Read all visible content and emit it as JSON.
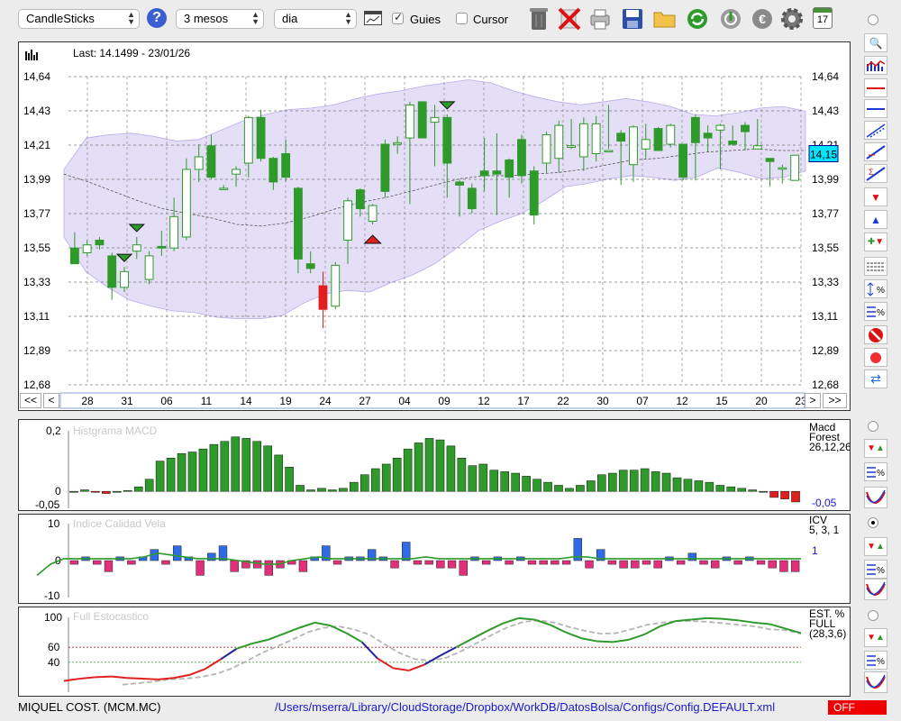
{
  "toolbar": {
    "chart_type": "CandleSticks",
    "period": "3 mesos",
    "interval": "dia",
    "guides_label": "Guies",
    "guides_checked": true,
    "cursor_label": "Cursor",
    "cursor_checked": false,
    "calendar_day": "17"
  },
  "price_chart": {
    "last_label": "Last: 14.1499 - 23/01/26",
    "current_price": "14,15",
    "y_ticks": [
      "14,64",
      "14,43",
      "14,21",
      "13,99",
      "13,77",
      "13,55",
      "13,33",
      "13,11",
      "12,89",
      "12,68"
    ],
    "x_ticks": [
      "28",
      "31",
      "06",
      "11",
      "14",
      "19",
      "24",
      "27",
      "04",
      "09",
      "12",
      "17",
      "22",
      "30",
      "07",
      "12",
      "15",
      "20",
      "23"
    ]
  },
  "nav": {
    "first": "<<",
    "prev": "<",
    "next": ">",
    "last": ">>"
  },
  "macd": {
    "title": "Histgrama MACD",
    "y_ticks": [
      "0,2",
      "0",
      "-0,05"
    ],
    "legend": [
      "Macd",
      "Forest",
      "26,12,26"
    ],
    "value": "-0,05"
  },
  "icv": {
    "title": "Indice Calidad Vela",
    "y_ticks": [
      "10",
      "0",
      "-10"
    ],
    "legend": [
      "ICV",
      "5, 3, 1"
    ],
    "value": "1"
  },
  "stoch": {
    "title": "Full Estocastico",
    "y_ticks": [
      "100",
      "60",
      "40"
    ],
    "legend": [
      "EST. %",
      "FULL",
      "(28,3,6)"
    ]
  },
  "status": {
    "instrument": "MIQUEL COST. (MCM.MC)",
    "path": "/Users/mserra/Library/CloudStorage/Dropbox/WorkDB/DatosBolsa/Configs/Config.DEFAULT.xml",
    "state": "OFF"
  },
  "colors": {
    "up": "#2e9a2a",
    "down": "#e21f1f",
    "band": "#ddd6f4",
    "accent": "#00e5ff",
    "hist_pos": "#2e9a2a",
    "hist_neg": "#e21f1f",
    "icv_pos": "#2f6be6",
    "icv_neg": "#e0307a"
  },
  "chart_data": [
    {
      "type": "candlestick",
      "ylim": [
        12.68,
        14.64
      ],
      "values_ohlc": [
        [
          13.55,
          13.45,
          13.65,
          13.45
        ],
        [
          13.52,
          13.57,
          13.6,
          13.5
        ],
        [
          13.6,
          13.57,
          13.62,
          13.54
        ],
        [
          13.5,
          13.3,
          13.52,
          13.22
        ],
        [
          13.3,
          13.4,
          13.43,
          13.27
        ],
        [
          13.53,
          13.57,
          13.62,
          13.48
        ],
        [
          13.35,
          13.5,
          13.53,
          13.32
        ],
        [
          13.56,
          13.55,
          13.66,
          13.5
        ],
        [
          13.55,
          13.75,
          13.87,
          13.53
        ],
        [
          13.62,
          14.05,
          14.12,
          13.6
        ],
        [
          14.05,
          14.13,
          14.21,
          13.97
        ],
        [
          14.2,
          14.0,
          14.27,
          13.99
        ],
        [
          13.93,
          13.93,
          13.95,
          13.92
        ],
        [
          14.02,
          14.05,
          14.07,
          13.94
        ],
        [
          14.09,
          14.38,
          14.39,
          14.0
        ],
        [
          14.38,
          14.12,
          14.43,
          14.1
        ],
        [
          14.12,
          13.97,
          14.13,
          13.92
        ],
        [
          14.15,
          14.0,
          14.24,
          13.97
        ],
        [
          13.93,
          13.48,
          13.94,
          13.39
        ],
        [
          13.45,
          13.42,
          13.53,
          13.39
        ],
        [
          13.31,
          13.16,
          13.4,
          13.04
        ],
        [
          13.18,
          13.44,
          13.46,
          13.16
        ],
        [
          13.6,
          13.85,
          13.87,
          13.45
        ],
        [
          13.92,
          13.8,
          13.93,
          13.75
        ],
        [
          13.72,
          13.82,
          13.83,
          13.7
        ],
        [
          14.21,
          13.91,
          14.24,
          13.87
        ],
        [
          14.21,
          14.22,
          14.26,
          14.15
        ],
        [
          14.25,
          14.46,
          14.48,
          13.83
        ],
        [
          14.48,
          14.25,
          14.48,
          14.25
        ],
        [
          14.35,
          14.38,
          14.46,
          14.07
        ],
        [
          14.38,
          14.09,
          14.4,
          13.87
        ],
        [
          13.97,
          13.95,
          13.98,
          13.75
        ],
        [
          13.93,
          13.8,
          13.96,
          13.77
        ],
        [
          14.04,
          14.01,
          14.25,
          13.91
        ],
        [
          14.04,
          14.02,
          14.28,
          13.76
        ],
        [
          14.11,
          14.0,
          14.12,
          13.87
        ],
        [
          14.24,
          14.01,
          14.27,
          13.96
        ],
        [
          14.04,
          13.76,
          14.07,
          13.7
        ],
        [
          14.09,
          14.27,
          14.29,
          14.03
        ],
        [
          14.12,
          14.33,
          14.36,
          14.03
        ],
        [
          14.19,
          14.2,
          14.37,
          14.18
        ],
        [
          14.13,
          14.34,
          14.38,
          14.04
        ],
        [
          14.15,
          14.34,
          14.39,
          14.1
        ],
        [
          14.17,
          14.17,
          14.46,
          14.18
        ],
        [
          14.28,
          14.23,
          14.3,
          13.95
        ],
        [
          14.08,
          14.32,
          14.33,
          13.97
        ],
        [
          14.18,
          14.24,
          14.34,
          14.12
        ],
        [
          14.31,
          14.17,
          14.32,
          14.18
        ],
        [
          14.21,
          14.33,
          14.34,
          14.19
        ],
        [
          14.21,
          14.0,
          14.21,
          13.98
        ],
        [
          14.38,
          14.22,
          14.4,
          13.98
        ],
        [
          14.28,
          14.25,
          14.33,
          14.16
        ],
        [
          14.3,
          14.33,
          14.34,
          14.05
        ],
        [
          14.23,
          14.21,
          14.33,
          14.2
        ],
        [
          14.33,
          14.29,
          14.35,
          14.17
        ],
        [
          14.18,
          14.2,
          14.37,
          14.2
        ],
        [
          14.12,
          14.1,
          14.11,
          13.94
        ],
        [
          14.06,
          14.06,
          14.08,
          13.96
        ],
        [
          13.98,
          14.14,
          14.14,
          13.98
        ]
      ],
      "bollinger_upper": [
        14.05,
        14.25,
        14.27,
        14.28,
        14.26,
        14.23,
        14.24,
        14.3,
        14.36,
        14.4,
        14.43,
        14.44,
        14.46,
        14.5,
        14.53,
        14.55,
        14.58,
        14.6,
        14.62,
        14.6,
        14.55,
        14.51,
        14.48,
        14.46,
        14.48,
        14.5,
        14.48,
        14.45,
        14.4,
        14.39,
        14.41,
        14.44,
        14.45,
        14.42
      ],
      "bollinger_lower": [
        13.62,
        13.4,
        13.3,
        13.22,
        13.18,
        13.15,
        13.14,
        13.11,
        13.1,
        13.1,
        13.12,
        13.2,
        13.26,
        13.28,
        13.27,
        13.33,
        13.38,
        13.45,
        13.55,
        13.66,
        13.72,
        13.77,
        13.85,
        13.94,
        13.96,
        13.99,
        14.01,
        14.0,
        13.98,
        14.0,
        14.06,
        14.03,
        13.99,
        14.0,
        14.04
      ],
      "sma": [
        14.02,
        13.97,
        13.91,
        13.85,
        13.8,
        13.77,
        13.74,
        13.7,
        13.69,
        13.71,
        13.75,
        13.8,
        13.84,
        13.87,
        13.91,
        13.95,
        13.99,
        14.01,
        14.01,
        14.02,
        14.03,
        14.05,
        14.08,
        14.11,
        14.12,
        14.14,
        14.16,
        14.17,
        14.18,
        14.17,
        14.17
      ],
      "signals": [
        "sell@4",
        "sell@5",
        "buy@24",
        "sell@30"
      ]
    },
    {
      "type": "bar",
      "name": "MACD",
      "ylim": [
        -0.05,
        0.2
      ],
      "values": [
        0,
        0.005,
        -0.003,
        -0.007,
        0,
        0.003,
        0.015,
        0.04,
        0.1,
        0.11,
        0.125,
        0.13,
        0.14,
        0.155,
        0.165,
        0.18,
        0.175,
        0.165,
        0.15,
        0.12,
        0.08,
        0.02,
        0.005,
        0.01,
        0.005,
        0.01,
        0.03,
        0.055,
        0.075,
        0.09,
        0.11,
        0.14,
        0.16,
        0.175,
        0.17,
        0.15,
        0.11,
        0.085,
        0.09,
        0.07,
        0.065,
        0.06,
        0.05,
        0.04,
        0.03,
        0.02,
        0.01,
        0.02,
        0.035,
        0.055,
        0.06,
        0.07,
        0.07,
        0.075,
        0.065,
        0.06,
        0.045,
        0.04,
        0.035,
        0.03,
        0.02,
        0.015,
        0.01,
        0.005,
        0,
        -0.02,
        -0.025,
        -0.035
      ]
    },
    {
      "type": "bar",
      "name": "ICV",
      "ylim": [
        -10,
        10
      ],
      "values": [
        -1,
        1,
        -1,
        -3,
        1,
        -1,
        1,
        3,
        -1,
        4,
        1,
        -4,
        2,
        4,
        -3,
        -2,
        -2,
        -4,
        -2,
        -1,
        -3,
        1,
        4,
        -1,
        1,
        1,
        3,
        1,
        -2,
        5,
        -1,
        -1,
        -2,
        -2,
        -4,
        1,
        -1,
        1,
        -1,
        1,
        -1,
        -1,
        -1,
        -1,
        6,
        -2,
        3,
        -1,
        -2,
        -2,
        -1,
        -2,
        1,
        -1,
        2,
        -1,
        -2,
        1,
        -1,
        1,
        -1,
        -2,
        -3,
        -3
      ]
    },
    {
      "type": "line",
      "name": "Full Stochastic",
      "ylim": [
        0,
        100
      ],
      "series": [
        {
          "values": [
            15,
            18,
            20,
            21,
            19,
            18,
            17,
            19,
            23,
            31,
            44,
            58,
            65,
            70,
            78,
            86,
            93,
            89,
            79,
            67,
            45,
            32,
            29,
            37,
            49,
            60,
            71,
            82,
            92,
            99,
            97,
            90,
            80,
            72,
            68,
            67,
            70,
            77,
            88,
            95,
            97,
            99,
            98,
            96,
            93,
            91,
            85,
            79
          ]
        },
        {
          "values": [
            10,
            12,
            14,
            17,
            18,
            20,
            24,
            31,
            41,
            52,
            61,
            70,
            80,
            86,
            88,
            84,
            77,
            64,
            52,
            44,
            42,
            46,
            55,
            66,
            77,
            87,
            94,
            96,
            93,
            87,
            82,
            78,
            79,
            84,
            90,
            93,
            95,
            95,
            94,
            92,
            90,
            88,
            84,
            83,
            78
          ]
        }
      ]
    }
  ]
}
